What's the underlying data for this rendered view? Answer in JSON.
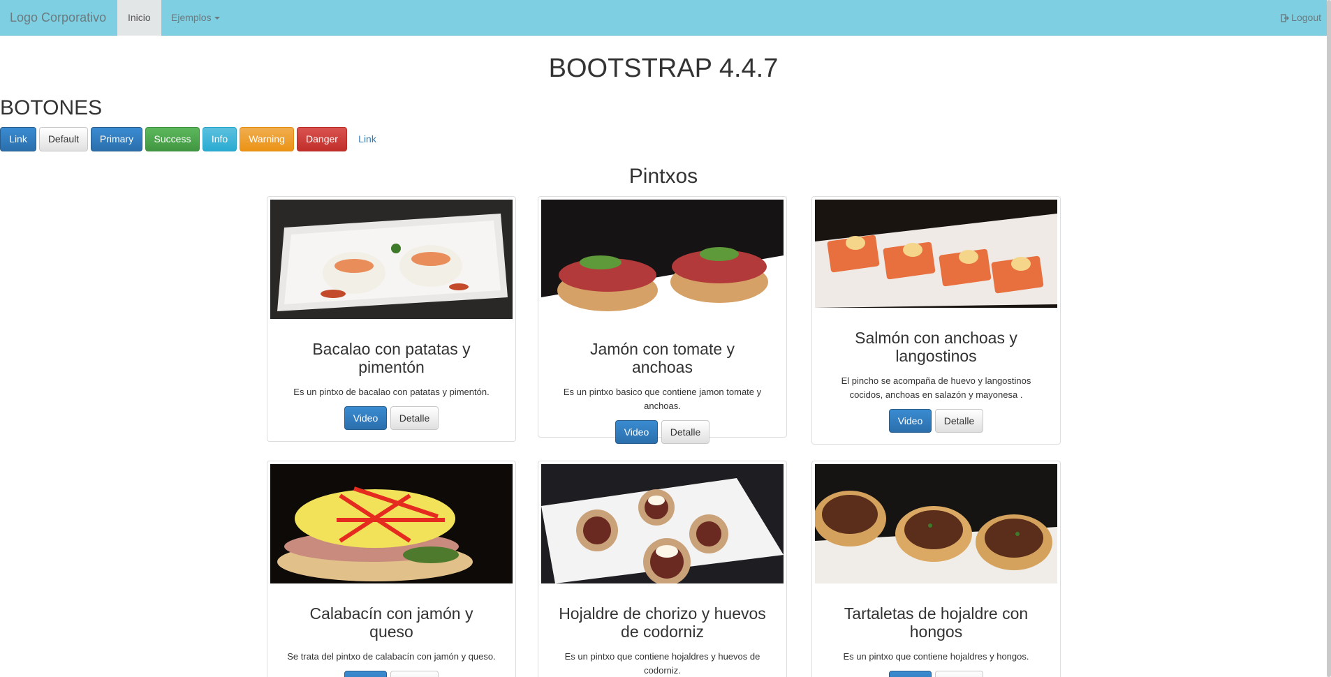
{
  "navbar": {
    "brand": "Logo Corporativo",
    "items": [
      {
        "label": "Inicio"
      },
      {
        "label": "Ejemplos"
      }
    ],
    "logout": "Logout"
  },
  "page": {
    "title": "BOOTSTRAP 4.4.7",
    "section": "BOTONES"
  },
  "buttons": [
    "Link",
    "Default",
    "Primary",
    "Success",
    "Info",
    "Warning",
    "Danger",
    "Link"
  ],
  "grid": {
    "title": "Pintxos",
    "video_label": "Video",
    "detalle_label": "Detalle"
  },
  "cards": [
    {
      "title": "Bacalao con patatas y pimentón",
      "desc": "Es un pintxo de bacalao con patatas y pimentón."
    },
    {
      "title": "Jamón con tomate y anchoas",
      "desc": "Es un pintxo basico que contiene jamon tomate y anchoas."
    },
    {
      "title": "Salmón con anchoas y langostinos",
      "desc": "El pincho se acompaña de huevo y langostinos cocidos, anchoas en salazón y mayonesa ."
    },
    {
      "title": "Calabacín con jamón y queso",
      "desc": "Se trata del pintxo de calabacín con jamón y queso."
    },
    {
      "title": "Hojaldre de chorizo y huevos de codorniz",
      "desc": "Es un pintxo que contiene hojaldres y huevos de codorniz."
    },
    {
      "title": "Tartaletas de hojaldre con hongos",
      "desc": "Es un pintxo que contiene hojaldres y hongos."
    }
  ],
  "icons": {
    "logout": "sign-out-icon",
    "dropdown": "caret-down-icon"
  },
  "colors": {
    "navbar": "#7ecfe2",
    "primary": "#337ab7",
    "success": "#5cb85c",
    "info": "#5bc0de",
    "warning": "#f0ad4e",
    "danger": "#d9534f"
  }
}
